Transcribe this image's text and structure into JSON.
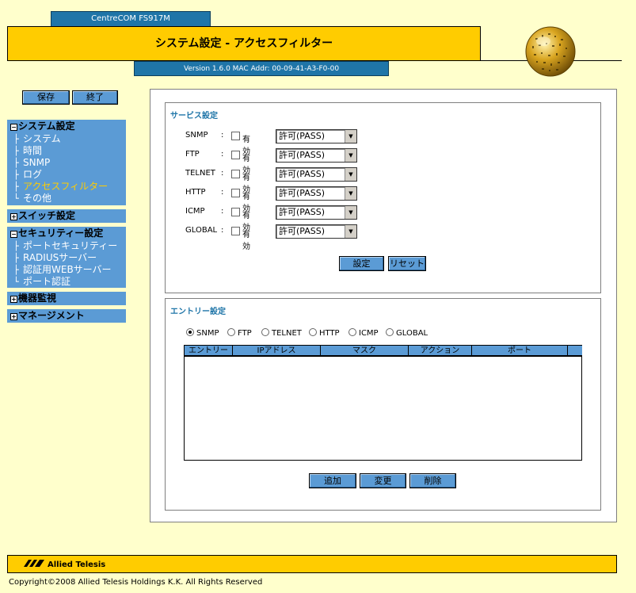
{
  "header": {
    "model": "CentreCOM FS917M",
    "title": "システム設定 - アクセスフィルター",
    "version_info": "Version 1.6.0 MAC Addr: 00-09-41-A3-F0-00"
  },
  "sidebar": {
    "save_label": "保存",
    "exit_label": "終了",
    "groups": [
      {
        "label": "システム設定",
        "expander": "−",
        "items": [
          {
            "label": "システム"
          },
          {
            "label": "時間"
          },
          {
            "label": "SNMP"
          },
          {
            "label": "ログ"
          },
          {
            "label": "アクセスフィルター",
            "active": true
          },
          {
            "label": "その他"
          }
        ]
      },
      {
        "label": "スイッチ設定",
        "expander": "+"
      },
      {
        "label": "セキュリティー設定",
        "expander": "−",
        "items": [
          {
            "label": "ポートセキュリティー"
          },
          {
            "label": "RADIUSサーバー"
          },
          {
            "label": "認証用WEBサーバー"
          },
          {
            "label": "ポート認証"
          }
        ]
      },
      {
        "label": "機器監視",
        "expander": "+"
      },
      {
        "label": "マネージメント",
        "expander": "+"
      }
    ]
  },
  "service": {
    "title": "サービス設定",
    "enable_label": "有効",
    "rows": [
      {
        "name": "SNMP",
        "enabled": false,
        "action": "許可(PASS)"
      },
      {
        "name": "FTP",
        "enabled": false,
        "action": "許可(PASS)"
      },
      {
        "name": "TELNET",
        "enabled": false,
        "action": "許可(PASS)"
      },
      {
        "name": "HTTP",
        "enabled": false,
        "action": "許可(PASS)"
      },
      {
        "name": "ICMP",
        "enabled": false,
        "action": "許可(PASS)"
      },
      {
        "name": "GLOBAL",
        "enabled": false,
        "action": "許可(PASS)"
      }
    ],
    "set_label": "設定",
    "reset_label": "リセット"
  },
  "entry": {
    "title": "エントリー設定",
    "protocols": [
      "SNMP",
      "FTP",
      "TELNET",
      "HTTP",
      "ICMP",
      "GLOBAL"
    ],
    "selected_protocol": "SNMP",
    "columns": [
      "エントリー",
      "IPアドレス",
      "マスク",
      "アクション",
      "ポート"
    ],
    "rows": [],
    "add_label": "追加",
    "change_label": "変更",
    "delete_label": "削除"
  },
  "footer": {
    "logo_text": "Allied Telesis",
    "copyright": "Copyright©2008 Allied Telesis Holdings K.K. All Rights Reserved"
  },
  "colors": {
    "background": "#ffffcc",
    "accent_blue": "#1f75a8",
    "menu_blue": "#5b9bd5",
    "title_yellow": "#ffcc00",
    "active_item": "#ffcc00"
  }
}
